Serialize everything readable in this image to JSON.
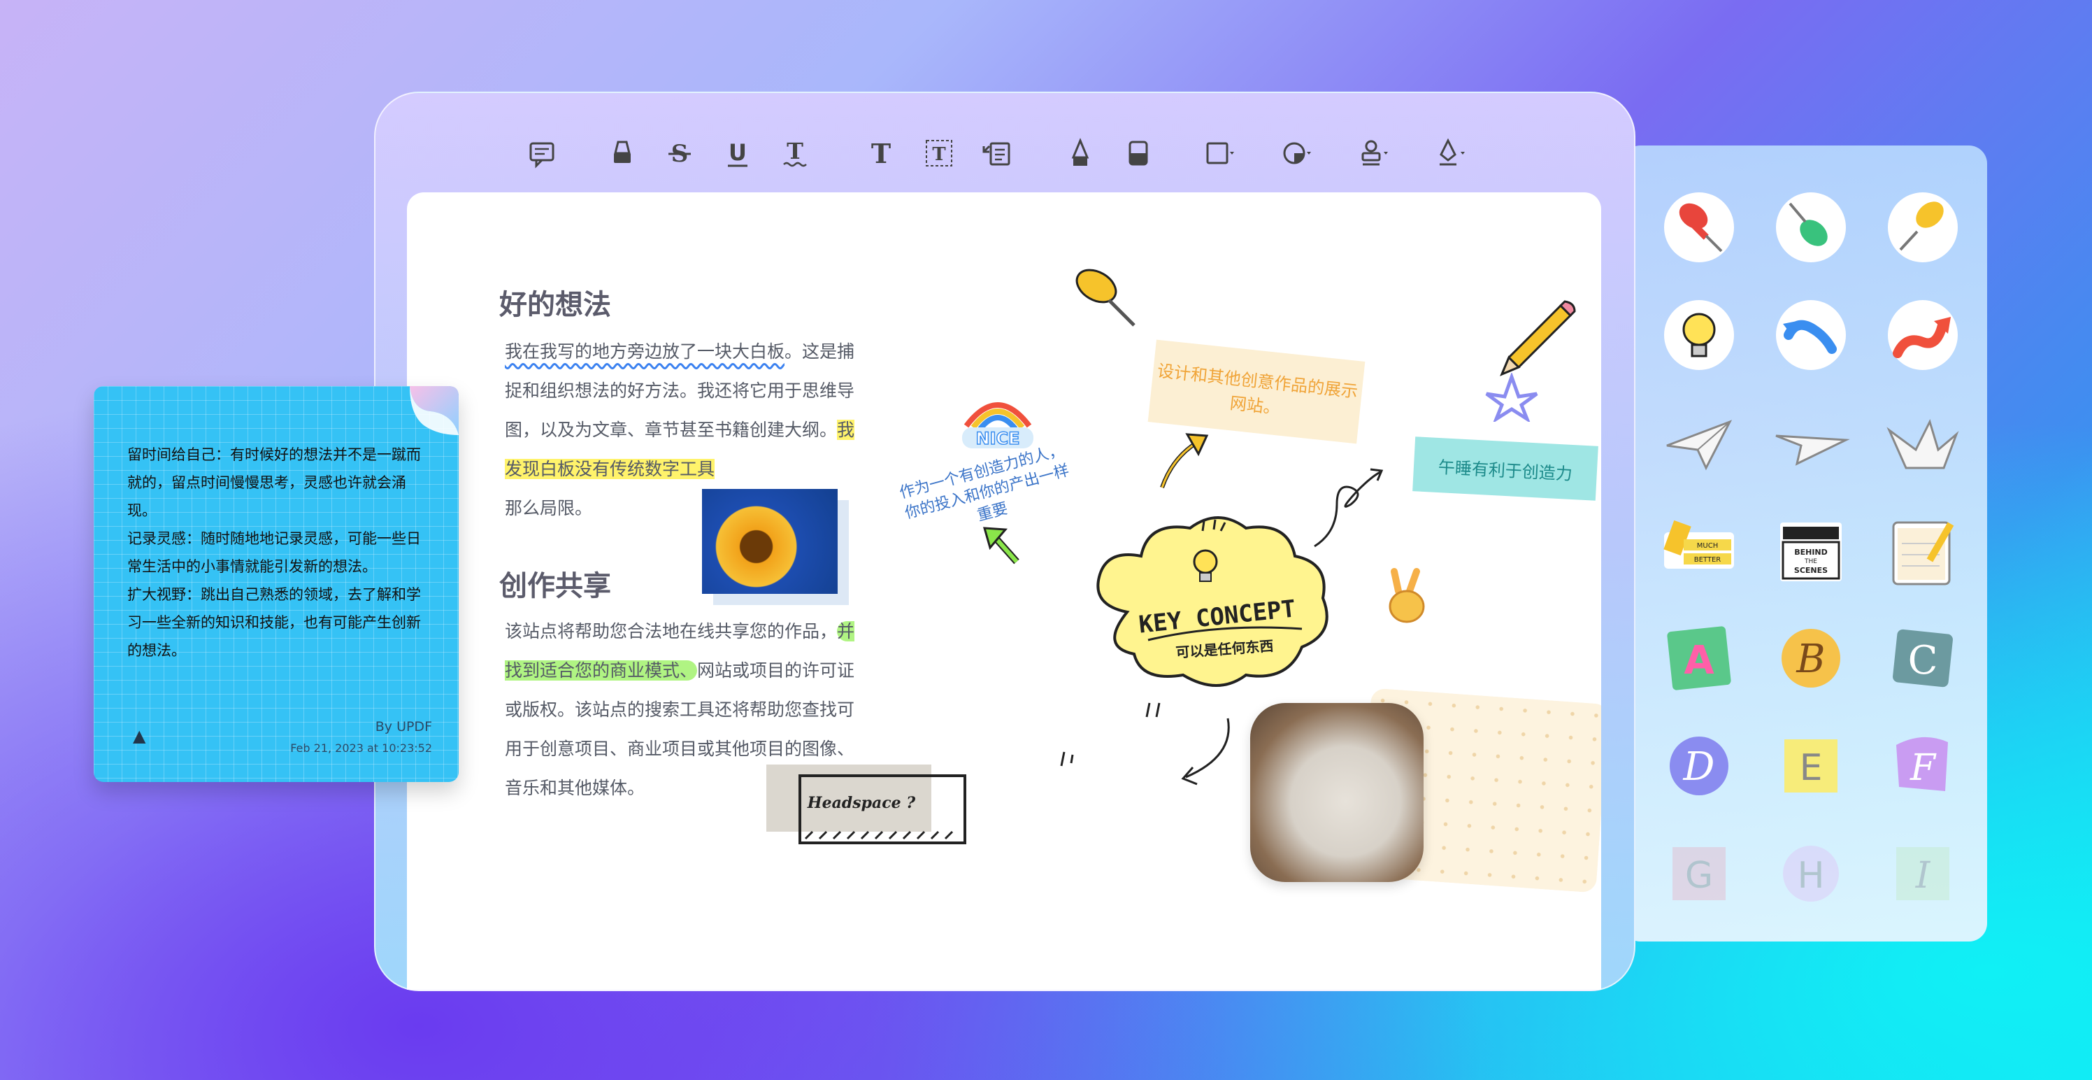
{
  "toolbar": {
    "tools": [
      {
        "name": "comment",
        "label": "comment-icon"
      },
      {
        "name": "highlight",
        "label": "highlighter-icon"
      },
      {
        "name": "strikethrough",
        "label": "strikethrough-icon"
      },
      {
        "name": "underline",
        "label": "underline-icon"
      },
      {
        "name": "squiggly",
        "label": "squiggly-icon"
      },
      {
        "name": "text",
        "label": "text-icon"
      },
      {
        "name": "textbox",
        "label": "textbox-icon"
      },
      {
        "name": "callout",
        "label": "text-callout-icon"
      },
      {
        "name": "pencil",
        "label": "pencil-icon"
      },
      {
        "name": "eraser",
        "label": "eraser-icon"
      },
      {
        "name": "shape",
        "label": "shape-icon"
      },
      {
        "name": "sticker",
        "label": "sticker-icon"
      },
      {
        "name": "stamp",
        "label": "stamp-icon"
      },
      {
        "name": "signature",
        "label": "signature-icon"
      }
    ],
    "glyphs": {
      "strike": "S",
      "underline": "U",
      "squiggly": "T",
      "text": "T",
      "textbox": "T"
    }
  },
  "doc": {
    "heading1": "好的想法",
    "para1_part1": "我在我写的地方旁边放了一块大白板",
    "para1_part2": "。这是捕捉和组织想法的好方法。我还将它用于思维导图，以及为文章、章节甚至书籍创建大纲。",
    "para1_highlight": "我发现白板没有传统数字工具",
    "para1_part3": "那么局限。",
    "heading2": "创作共享",
    "para2_part1": "该站点将帮助您合法地在线共享您的作品，",
    "para2_highlight": "并找到适合您的商业模式、",
    "para2_part2": "网站或项目的许可证或版权。该站点的搜索工具还将帮助您查找可用于创意项目、商业项目或其他项目的图像、音乐和其他媒体。"
  },
  "note": {
    "line1": "留时间给自己：有时候好的想法并不是一蹴而就的，留点时间慢慢思考，灵感也许就会涌现。",
    "line2": "记录灵感：随时随地地记录灵感，可能一些日常生活中的小事情就能引发新的想法。",
    "line3": "扩大视野：跳出自己熟悉的领域，去了解和学习一些全新的知识和技能，也有可能产生创新的想法。",
    "author": "By UPDF",
    "date": "Feb 21, 2023 at 10:23:52",
    "color": "#35c2f5"
  },
  "board": {
    "sticky_orange": "设计和其他创意作品的展示网站。",
    "sticky_teal": "午睡有利于创造力",
    "nice_text": "NICE",
    "creative_text": "作为一个有创造力的人，你的投入和你的产出一样重要",
    "key_concept": "KEY CONCEPT",
    "key_sub": "可以是任何东西",
    "headspace": "Headspace ?"
  },
  "stickers": {
    "items": [
      {
        "name": "red-pin",
        "label": ""
      },
      {
        "name": "green-pin",
        "label": ""
      },
      {
        "name": "yellow-pin",
        "label": ""
      },
      {
        "name": "lightbulb",
        "label": ""
      },
      {
        "name": "blue-arrow",
        "label": ""
      },
      {
        "name": "red-arrow",
        "label": ""
      },
      {
        "name": "paper-plane-1",
        "label": ""
      },
      {
        "name": "paper-plane-2",
        "label": ""
      },
      {
        "name": "paper-crane",
        "label": ""
      },
      {
        "name": "much-better",
        "label": "MUCH BETTER"
      },
      {
        "name": "behind-scenes",
        "label": "BEHIND THE SCENES"
      },
      {
        "name": "notepad",
        "label": ""
      },
      {
        "name": "letter-a",
        "label": "A"
      },
      {
        "name": "letter-b",
        "label": "B"
      },
      {
        "name": "letter-c",
        "label": "C"
      },
      {
        "name": "letter-d",
        "label": "D"
      },
      {
        "name": "letter-e",
        "label": "E"
      },
      {
        "name": "letter-f",
        "label": "F"
      },
      {
        "name": "letter-g",
        "label": "G"
      },
      {
        "name": "letter-h",
        "label": "H"
      },
      {
        "name": "letter-i",
        "label": "I"
      }
    ]
  }
}
